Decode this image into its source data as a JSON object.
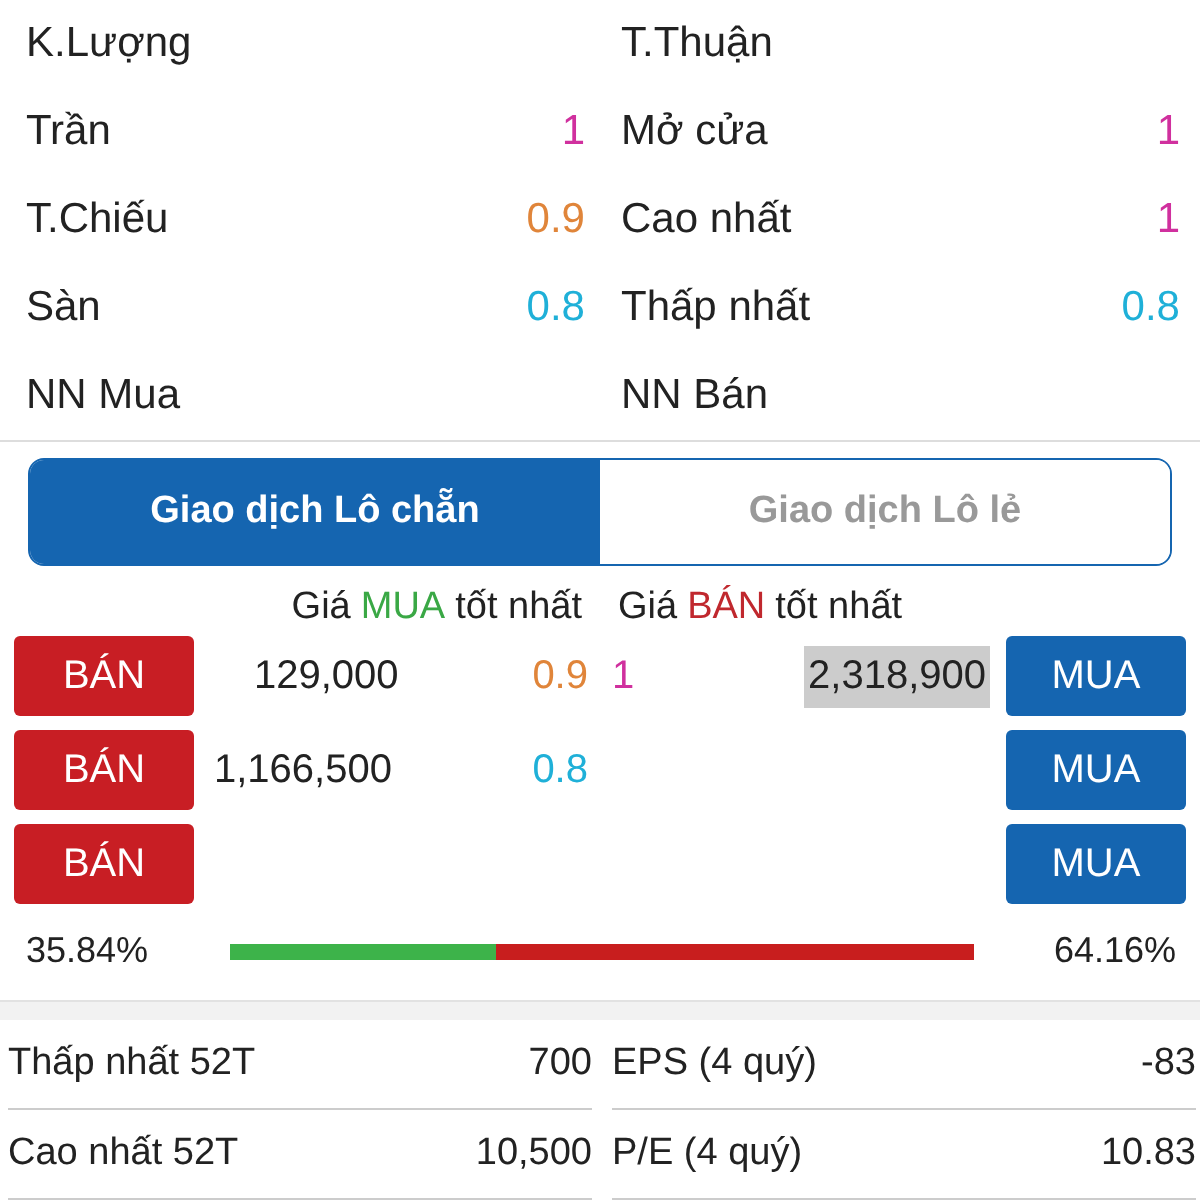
{
  "stats": [
    {
      "left": {
        "label": "K.Lượng"
      },
      "right": {
        "label": "T.Thuận"
      }
    },
    {
      "left": {
        "label": "Trần",
        "value": "1",
        "color": "#d0309e"
      },
      "right": {
        "label": "Mở cửa",
        "value": "1",
        "color": "#d0309e"
      }
    },
    {
      "left": {
        "label": "T.Chiếu",
        "value": "0.9",
        "color": "#e0853a"
      },
      "right": {
        "label": "Cao nhất",
        "value": "1",
        "color": "#d0309e"
      }
    },
    {
      "left": {
        "label": "Sàn",
        "value": "0.8",
        "color": "#1fb0d8"
      },
      "right": {
        "label": "Thấp nhất",
        "value": "0.8",
        "color": "#1fb0d8"
      }
    },
    {
      "left": {
        "label": "NN Mua"
      },
      "right": {
        "label": "NN Bán"
      }
    }
  ],
  "tabs": [
    {
      "label": "Giao dịch Lô chẵn",
      "selected": true
    },
    {
      "label": "Giao dịch Lô lẻ",
      "selected": false
    }
  ],
  "best_headers": [
    {
      "prefix": "Giá",
      "side": "MUA",
      "suffix": "tốt nhất",
      "kind": "buy"
    },
    {
      "prefix": "Giá",
      "side": "BÁN",
      "suffix": "tốt nhất",
      "kind": "sell"
    }
  ],
  "orders": [
    {
      "sell_button": "BÁN",
      "bid_volume": "129,000",
      "bid_price": {
        "value": "0.9",
        "color": "#e0853a"
      },
      "ask_price": {
        "value": "1",
        "color": "#d0309e"
      },
      "ask_volume": "2,318,900",
      "ask_highlighted": true,
      "buy_button": "MUA"
    },
    {
      "sell_button": "BÁN",
      "bid_volume": "1,166,500",
      "bid_price": {
        "value": "0.8",
        "color": "#1fb0d8"
      },
      "buy_button": "MUA"
    },
    {
      "sell_button": "BÁN",
      "buy_button": "MUA"
    }
  ],
  "balance": {
    "buy_pct": "35.84%",
    "sell_pct": "64.16%",
    "level": 0.3584
  },
  "fundamentals": [
    {
      "left": {
        "label": "Thấp nhất 52T",
        "value": "700"
      },
      "right": {
        "label": "EPS (4 quý)",
        "value": "-83"
      }
    },
    {
      "left": {
        "label": "Cao nhất 52T",
        "value": "10,500"
      },
      "right": {
        "label": "P/E (4 quý)",
        "value": "10.83"
      }
    }
  ]
}
